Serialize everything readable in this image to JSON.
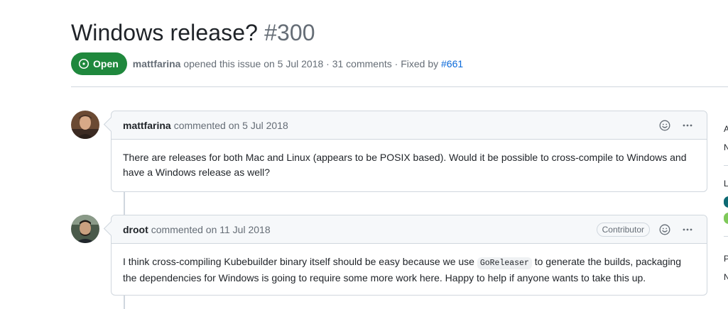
{
  "issue": {
    "title": "Windows release?",
    "number": "#300",
    "state": "Open",
    "author": "mattfarina",
    "meta_opened": "opened this issue on 5 Jul 2018 · 31 comments · Fixed by",
    "fixed_by": "#661"
  },
  "comments": [
    {
      "author": "mattfarina",
      "meta": "commented on 5 Jul 2018",
      "badge": "",
      "body": "There are releases for both Mac and Linux (appears to be POSIX based). Would it be possible to cross-compile to Windows and have a Windows release as well?"
    },
    {
      "author": "droot",
      "meta": "commented on 11 Jul 2018",
      "badge": "Contributor",
      "body_before": "I think cross-compiling Kubebuilder binary itself should be easy because we use",
      "body_code": "GoReleaser",
      "body_after": "to generate the builds, packaging the dependencies for Windows is going to require some more work here. Happy to help if anyone wants to take this up."
    }
  ],
  "sidebar_fragments": [
    "A",
    "N",
    "L",
    "P",
    "N"
  ],
  "colors": {
    "open_green": "#1f883d",
    "link_blue": "#0969da",
    "border": "#d0d7de",
    "label_teal": "#0e6a73",
    "label_lime": "#7fc95a"
  },
  "icons": [
    "issue-open-icon",
    "smiley-icon",
    "kebab-horizontal-icon"
  ]
}
